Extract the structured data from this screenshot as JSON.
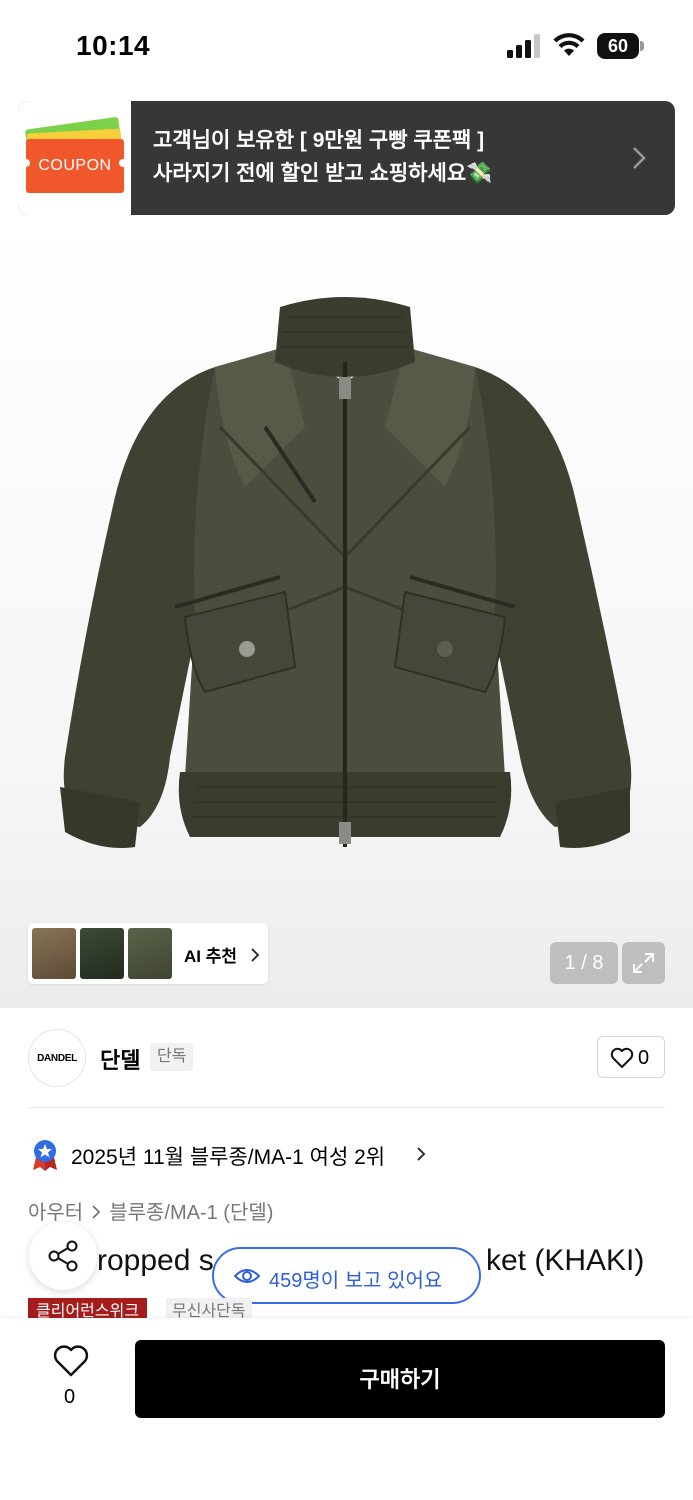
{
  "status_bar": {
    "time": "10:14",
    "battery": "60"
  },
  "banner": {
    "coupon_label": "COUPON",
    "line1": "고객님이 보유한 [ 9만원 구빵 쿠폰팩 ]",
    "line2": "사라지기 전에 할인 받고 쇼핑하세요💸"
  },
  "gallery": {
    "ai_label": "AI 추천",
    "pager": "1 / 8"
  },
  "brand": {
    "logo_text": "DANDEL",
    "name": "단델",
    "tag": "단독",
    "like_count": "0"
  },
  "ranking": {
    "text": "2025년 11월 블루종/MA-1 여성 2위"
  },
  "breadcrumb": [
    "아우터",
    "블루종/MA-1 (단델)"
  ],
  "product": {
    "title": "Cropped stitched Jacket (KHAKI)",
    "title_visible_left": "ropped s",
    "title_visible_right": "ket (KHAKI)",
    "viewing": "459명이 보고 있어요",
    "tags": [
      "클리어런스위크",
      "무신사단독"
    ]
  },
  "bottom_bar": {
    "like_count": "0",
    "buy_label": "구매하기"
  },
  "colors": {
    "banner_bg": "#373737",
    "coupon_orange": "#f0572a",
    "viewing_blue": "#2c5fd8",
    "tag_red": "#a51c1c",
    "jacket": "#474a38"
  }
}
